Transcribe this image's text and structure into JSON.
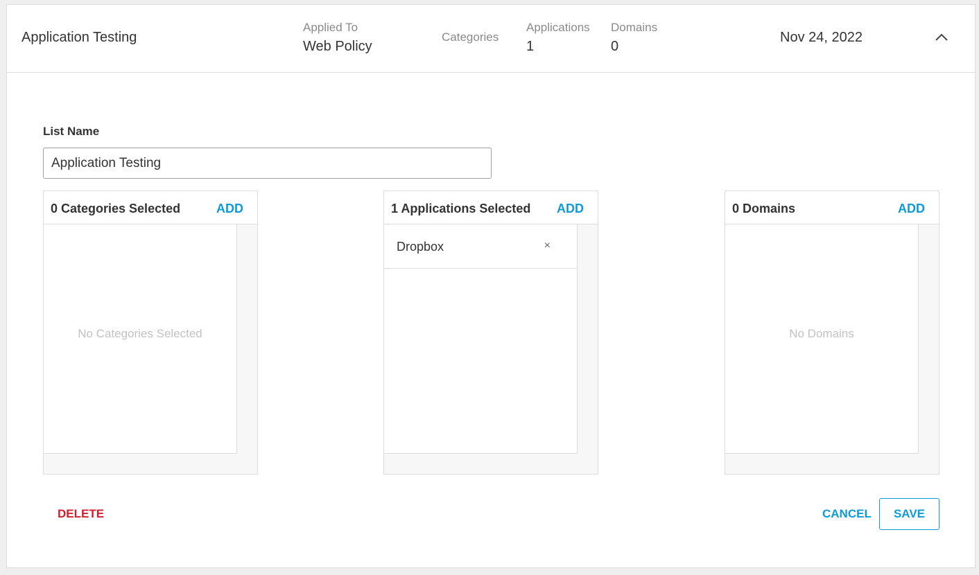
{
  "header": {
    "title": "Application Testing",
    "applied_to": {
      "label": "Applied To",
      "value": "Web Policy"
    },
    "categories": {
      "label": "Categories"
    },
    "applications": {
      "label": "Applications",
      "value": "1"
    },
    "domains": {
      "label": "Domains",
      "value": "0"
    },
    "date": "Nov 24, 2022",
    "collapse_icon": "chevron-up-icon"
  },
  "list_name": {
    "label": "List Name",
    "value": "Application Testing"
  },
  "panels": {
    "categories": {
      "title": "0 Categories Selected",
      "add": "ADD",
      "empty": "No Categories Selected"
    },
    "applications": {
      "title": "1 Applications Selected",
      "add": "ADD",
      "items": [
        "Dropbox"
      ],
      "remove_glyph": "×"
    },
    "domains": {
      "title": "0 Domains",
      "add": "ADD",
      "empty": "No Domains"
    }
  },
  "footer": {
    "delete": "DELETE",
    "cancel": "CANCEL",
    "save": "SAVE"
  },
  "colors": {
    "accent": "#0d9bd8",
    "danger": "#cf2030",
    "muted_text": "#8a8a8a",
    "empty_text": "#c2c2c2"
  }
}
